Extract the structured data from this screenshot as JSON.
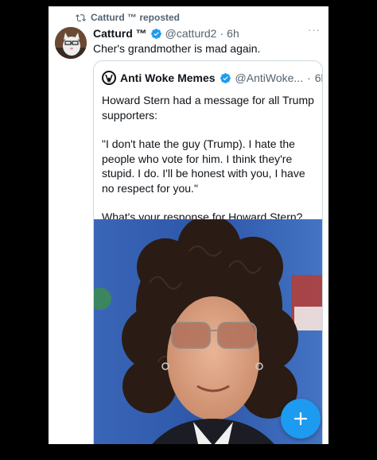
{
  "repost_label": "Catturd ™ reposted",
  "tweet": {
    "name": "Catturd ™",
    "handle": "@catturd2",
    "dot": "·",
    "time": "6h",
    "more": "···",
    "text": "Cher's grandmother is mad again."
  },
  "quote": {
    "name": "Anti Woke Memes",
    "handle": "@AntiWoke...",
    "dot": "·",
    "time": "6h",
    "paragraphs": [
      "Howard Stern had a message for all Trump supporters:",
      "\"I don't hate the guy (Trump). I hate the people who vote for him. I think they're stupid. I do. I'll be honest with you, I have no respect for you.\"",
      "What's your response for Howard Stern?"
    ]
  },
  "colors": {
    "accent": "#1d9bf0",
    "text": "#0f1419",
    "muted": "#536471"
  },
  "icons": {
    "repost": "repost-icon",
    "verified": "verified-badge-icon",
    "compose": "plus-icon"
  }
}
